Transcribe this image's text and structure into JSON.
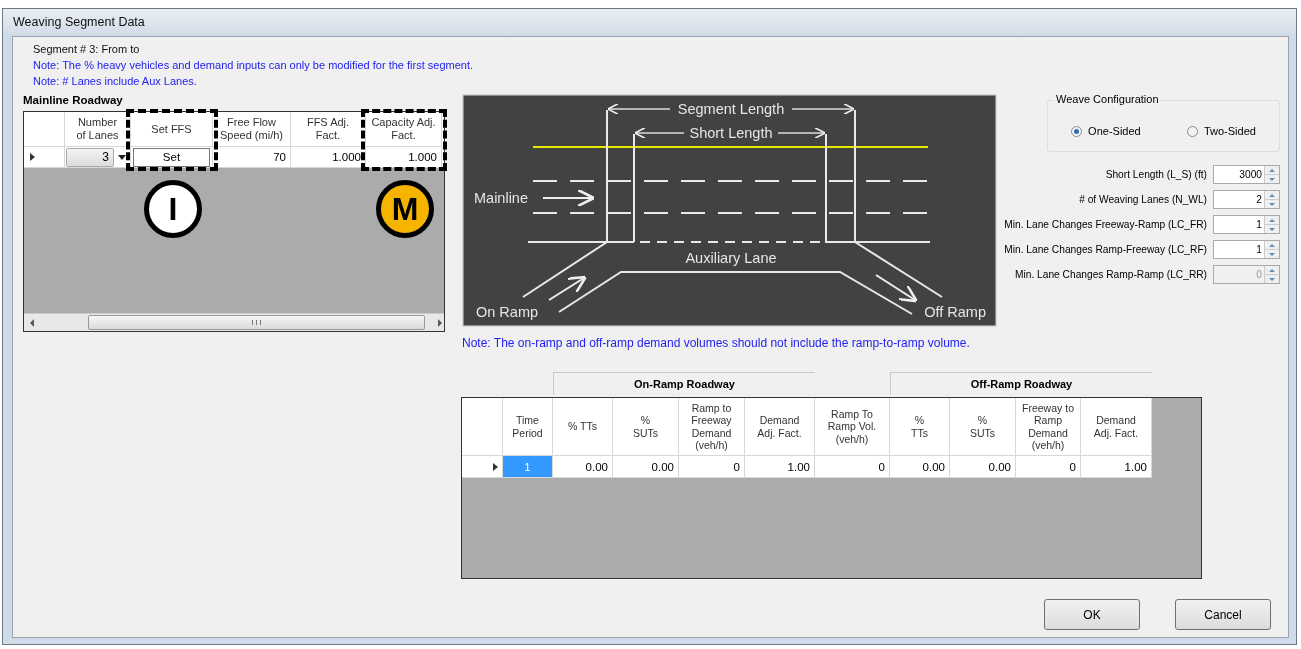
{
  "window": {
    "title": "Weaving Segment Data"
  },
  "segment_label": "Segment # 3:  From  to",
  "notes": [
    "Note: The % heavy vehicles and demand inputs can only be modified for the first segment.",
    "Note: # Lanes include Aux Lanes."
  ],
  "mainline": {
    "title": "Mainline Roadway",
    "columns": [
      {
        "header": "Number\nof Lanes",
        "highlighted": false
      },
      {
        "header": "Set FFS",
        "highlighted": true,
        "marker": {
          "label": "I",
          "color": "#ffffff"
        }
      },
      {
        "header": "Free Flow\nSpeed (mi/h)",
        "highlighted": false
      },
      {
        "header": "FFS Adj.\nFact.",
        "highlighted": false
      },
      {
        "header": "Capacity Adj.\nFact.",
        "highlighted": true,
        "marker": {
          "label": "M",
          "color": "#f5b400"
        }
      }
    ],
    "rows": [
      {
        "cells": [
          {
            "kind": "dropdown",
            "value": "3"
          },
          {
            "kind": "button",
            "value": "Set"
          },
          {
            "kind": "number",
            "value": "70"
          },
          {
            "kind": "number",
            "value": "1.000"
          },
          {
            "kind": "number",
            "value": "1.000"
          }
        ]
      }
    ]
  },
  "diagram": {
    "labels": [
      "Segment Length",
      "Short Length",
      "Mainline",
      "Auxiliary Lane",
      "On Ramp",
      "Off Ramp"
    ]
  },
  "ramp_note": "Note: The on-ramp and off-ramp demand volumes should not include the ramp-to-ramp volume.",
  "weave_configuration": {
    "title": "Weave Configuration",
    "options": [
      {
        "label": "One-Sided",
        "selected": true
      },
      {
        "label": "Two-Sided",
        "selected": false
      }
    ]
  },
  "parameters": [
    {
      "label": "Short Length (L_S) (ft)",
      "value": "3000",
      "disabled": false
    },
    {
      "label": "# of Weaving Lanes (N_WL)",
      "value": "2",
      "disabled": false
    },
    {
      "label": "Min. Lane Changes Freeway-Ramp (LC_FR)",
      "value": "1",
      "disabled": false
    },
    {
      "label": "Min. Lane Changes Ramp-Freeway (LC_RF)",
      "value": "1",
      "disabled": false
    },
    {
      "label": "Min. Lane Changes Ramp-Ramp (LC_RR)",
      "value": "0",
      "disabled": true
    }
  ],
  "demand_table": {
    "group_headers": [
      "On-Ramp Roadway",
      "Off-Ramp Roadway"
    ],
    "columns": [
      {
        "header": "Time\nPeriod"
      },
      {
        "header": "% TTs"
      },
      {
        "header": "%\nSUTs"
      },
      {
        "header": "Ramp to\nFreeway\nDemand\n(veh/h)"
      },
      {
        "header": "Demand\nAdj. Fact."
      },
      {
        "header": "Ramp To\nRamp Vol.\n(veh/h)"
      },
      {
        "header": "%\nTTs"
      },
      {
        "header": "%\nSUTs"
      },
      {
        "header": "Freeway to\nRamp\nDemand\n(veh/h)"
      },
      {
        "header": "Demand\nAdj. Fact."
      }
    ],
    "rows": [
      {
        "cells": [
          {
            "value": "1",
            "selected": true
          },
          {
            "value": "0.00",
            "selected": false
          },
          {
            "value": "0.00",
            "selected": false
          },
          {
            "value": "0",
            "selected": false
          },
          {
            "value": "1.00",
            "selected": false
          },
          {
            "value": "0",
            "selected": false
          },
          {
            "value": "0.00",
            "selected": false
          },
          {
            "value": "0.00",
            "selected": false
          },
          {
            "value": "0",
            "selected": false
          },
          {
            "value": "1.00",
            "selected": false
          }
        ]
      }
    ]
  },
  "buttons": [
    "OK",
    "Cancel"
  ]
}
